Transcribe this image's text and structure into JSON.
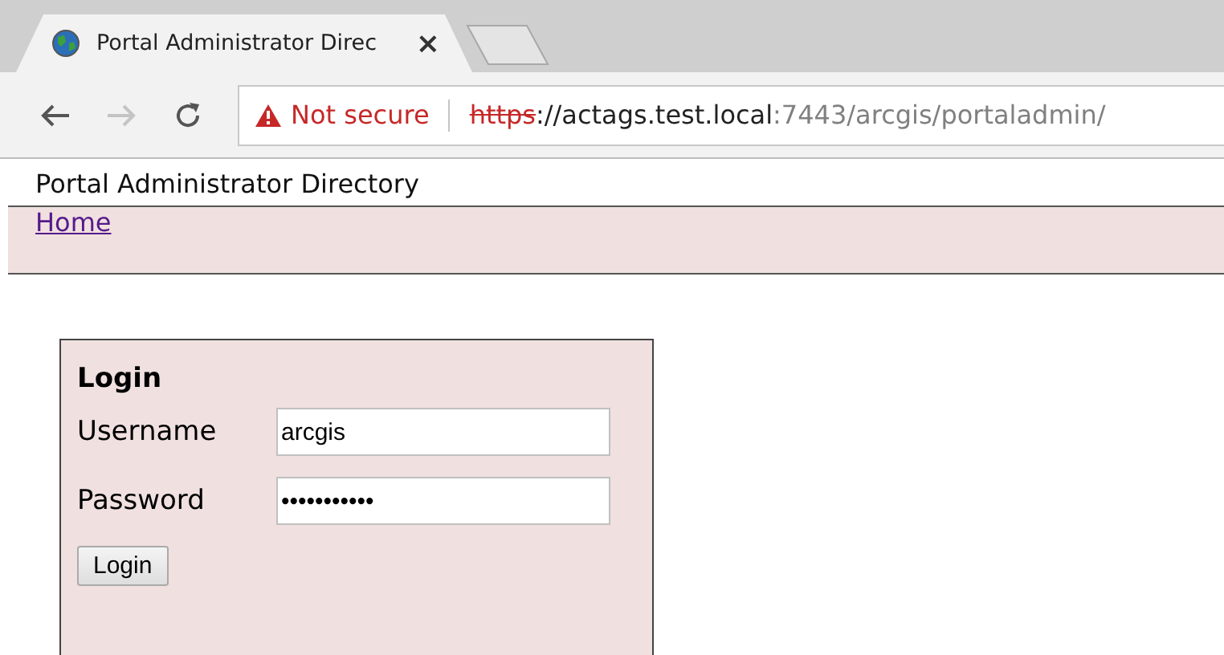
{
  "browser": {
    "tab": {
      "title": "Portal Administrator Direc",
      "close": "×",
      "selected": true
    },
    "address_bar": {
      "security": "Not secure",
      "scheme": "https",
      "host": "://actags.test.local",
      "path": ":7443/arcgis/portaladmin/"
    }
  },
  "page": {
    "title": "Portal Administrator Directory",
    "nav_link": "Home",
    "login": {
      "heading": "Login",
      "fields": [
        {
          "label": "Username",
          "value": "arcgis"
        },
        {
          "label": "Password",
          "value": "•••••••••••"
        }
      ],
      "button": "Login"
    }
  }
}
